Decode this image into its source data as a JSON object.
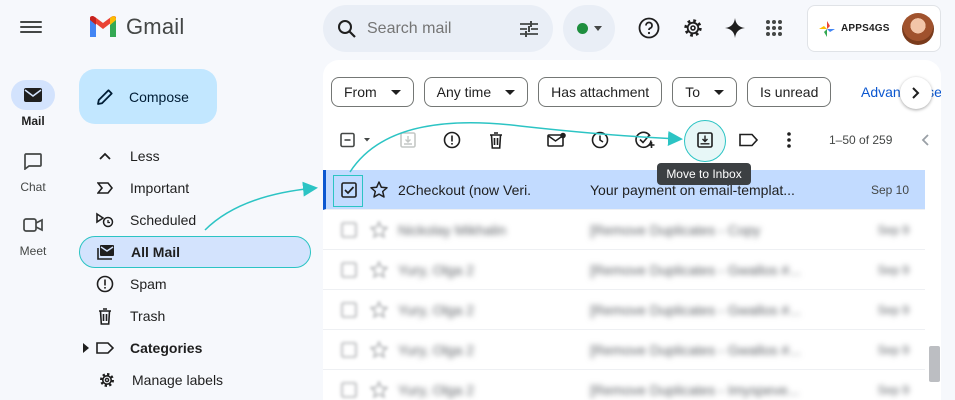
{
  "rail": {
    "items": [
      {
        "label": "Mail",
        "icon": "mail-icon",
        "active": true
      },
      {
        "label": "Chat",
        "icon": "chat-icon",
        "active": false
      },
      {
        "label": "Meet",
        "icon": "video-icon",
        "active": false
      }
    ]
  },
  "app": {
    "name": "Gmail"
  },
  "compose": {
    "label": "Compose"
  },
  "nav": {
    "items": [
      {
        "label": "Less",
        "icon": "chevron-up-icon"
      },
      {
        "label": "Important",
        "icon": "important-icon"
      },
      {
        "label": "Scheduled",
        "icon": "scheduled-icon"
      },
      {
        "label": "All Mail",
        "icon": "all-mail-icon",
        "active": true
      },
      {
        "label": "Spam",
        "icon": "spam-icon"
      },
      {
        "label": "Trash",
        "icon": "trash-icon"
      },
      {
        "label": "Categories",
        "icon": "label-icon",
        "bold": true
      },
      {
        "label": "Manage labels",
        "icon": "gear-icon"
      }
    ]
  },
  "search": {
    "placeholder": "Search mail"
  },
  "account": {
    "brand": "APPS4GS"
  },
  "filters": {
    "chips": [
      "From",
      "Any time",
      "Has attachment",
      "To",
      "Is unread"
    ],
    "chip_dropdown": [
      true,
      true,
      false,
      true,
      false
    ],
    "advanced": "Advanced search"
  },
  "toolbar": {
    "pager": "1–50 of 259",
    "tooltip": "Move to Inbox"
  },
  "messages": [
    {
      "sender": "2Checkout (now Veri.",
      "subject": "Your payment on email-templat...",
      "date": "Sep 10",
      "selected": true,
      "blurred": false
    },
    {
      "sender": "Nickolay Mikhalin",
      "subject": "[Remove Duplicates - Copy",
      "date": "Sep 9",
      "selected": false,
      "blurred": true
    },
    {
      "sender": "Yury, Olga 2",
      "subject": "[Remove Duplicates - Gwallos #...",
      "date": "Sep 9",
      "selected": false,
      "blurred": true
    },
    {
      "sender": "Yury, Olga 2",
      "subject": "[Remove Duplicates - Gwallos #...",
      "date": "Sep 9",
      "selected": false,
      "blurred": true
    },
    {
      "sender": "Yury, Olga 2",
      "subject": "[Remove Duplicates - Gwallos #...",
      "date": "Sep 9",
      "selected": false,
      "blurred": true
    },
    {
      "sender": "Yury, Olga 2",
      "subject": "[Remove Duplicates - Imyspeve...",
      "date": "Sep 9",
      "selected": false,
      "blurred": true
    }
  ],
  "colors": {
    "accent": "#0b57d0",
    "highlight": "#2cc4c4",
    "selected_row": "#c2dbff",
    "compose_bg": "#c2e7ff"
  }
}
